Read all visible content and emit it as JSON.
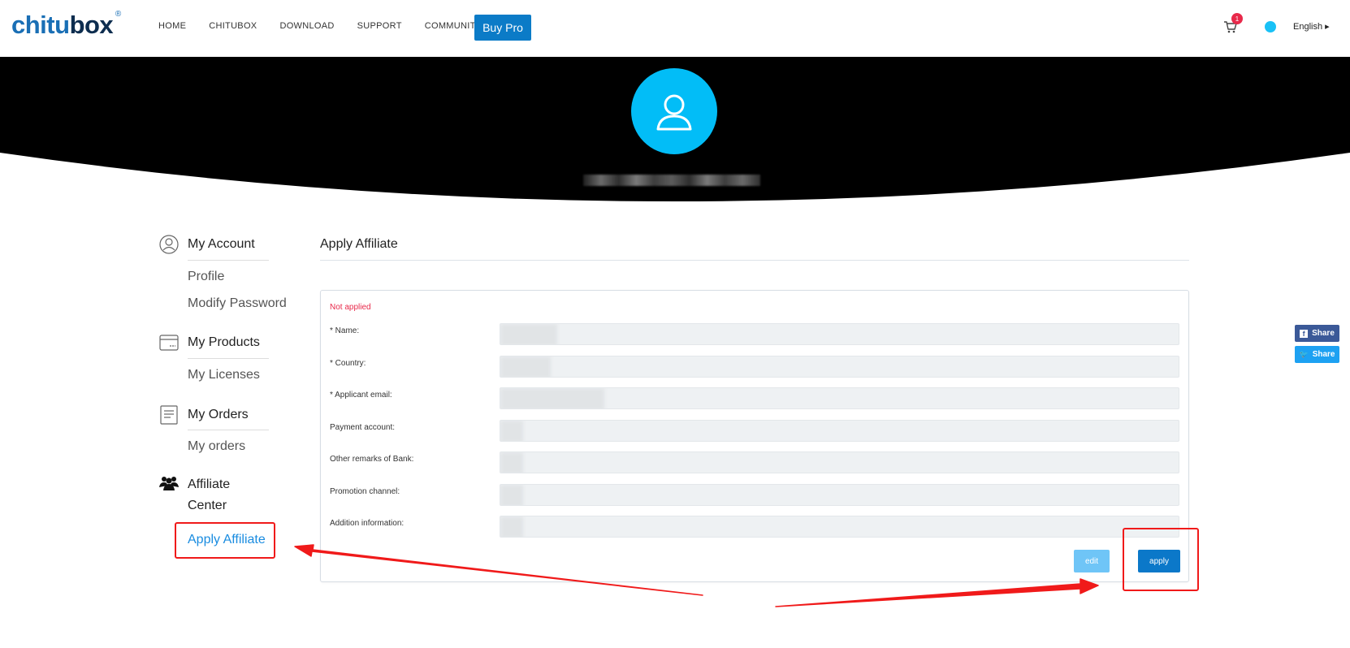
{
  "header": {
    "logo": {
      "part1": "chitu",
      "part2": "box",
      "reg": "®"
    },
    "nav": [
      "HOME",
      "CHITUBOX",
      "DOWNLOAD",
      "SUPPORT",
      "COMMUNITY"
    ],
    "buy_pro": "Buy Pro",
    "cart_count": "1",
    "language": "English"
  },
  "sidebar": {
    "account": {
      "title": "My Account",
      "links": [
        "Profile",
        "Modify Password"
      ]
    },
    "products": {
      "title": "My Products",
      "links": [
        "My Licenses"
      ]
    },
    "orders": {
      "title": "My Orders",
      "links": [
        "My orders"
      ]
    },
    "affiliate": {
      "title_line1": "Affiliate",
      "title_line2": "Center",
      "links": [
        "Apply Affiliate"
      ]
    }
  },
  "main": {
    "title": "Apply Affiliate",
    "status": "Not applied",
    "fields": [
      {
        "label": "* Name:",
        "value": ""
      },
      {
        "label": "* Country:",
        "value": ""
      },
      {
        "label": "* Applicant email:",
        "value": ""
      },
      {
        "label": "Payment account:",
        "value": ""
      },
      {
        "label": "Other remarks of Bank:",
        "value": ""
      },
      {
        "label": "Promotion channel:",
        "value": ""
      },
      {
        "label": "Addition information:",
        "value": ""
      }
    ],
    "edit_label": "edit",
    "apply_label": "apply"
  },
  "share": {
    "facebook": "Share",
    "twitter": "Share"
  },
  "colors": {
    "brand_blue": "#0b7bc7",
    "logo_dark": "#0d2d4f",
    "avatar_cyan": "#02bdf7",
    "status_red": "#e8294a",
    "annotation_red": "#f01a1a"
  }
}
